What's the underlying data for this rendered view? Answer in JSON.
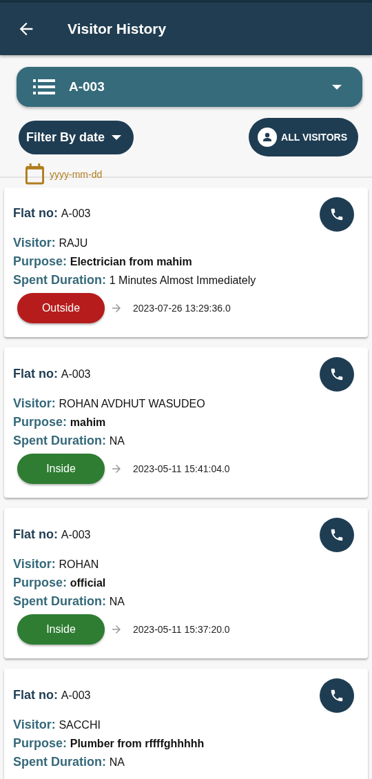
{
  "app_bar": {
    "title": "Visitor History"
  },
  "flat_select": {
    "value": "A-003"
  },
  "filter": {
    "label": "Filter By date",
    "all_visitors": "ALL VISITORS",
    "date_placeholder": "yyyy-mm-dd"
  },
  "visits": [
    {
      "flat_label": "Flat no:",
      "flat": "A-003",
      "visitor_label": "Visitor:",
      "visitor": "RAJU",
      "purpose_label": "Purpose:",
      "purpose": "Electrician from mahim",
      "duration_label": "Spent Duration:",
      "duration": "1 Minutes Almost Immediately",
      "status": {
        "kind": "outside",
        "label": "Outside",
        "time": "2023-07-26 13:29:36.0"
      }
    },
    {
      "flat_label": "Flat no:",
      "flat": "A-003",
      "visitor_label": "Visitor:",
      "visitor": "ROHAN AVDHUT WASUDEO",
      "purpose_label": "Purpose:",
      "purpose": "mahim",
      "duration_label": "Spent Duration:",
      "duration": "NA",
      "status": {
        "kind": "inside",
        "label": "Inside",
        "time": "2023-05-11 15:41:04.0"
      }
    },
    {
      "flat_label": "Flat no:",
      "flat": "A-003",
      "visitor_label": "Visitor:",
      "visitor": "ROHAN",
      "purpose_label": "Purpose:",
      "purpose": "official",
      "duration_label": "Spent Duration:",
      "duration": "NA",
      "status": {
        "kind": "inside",
        "label": "Inside",
        "time": "2023-05-11 15:37:20.0"
      }
    },
    {
      "flat_label": "Flat no:",
      "flat": "A-003",
      "visitor_label": "Visitor:",
      "visitor": "SACCHI",
      "purpose_label": "Purpose:",
      "purpose": "Plumber from rffffghhhhh",
      "duration_label": "Spent Duration:",
      "duration": "NA"
    }
  ]
}
